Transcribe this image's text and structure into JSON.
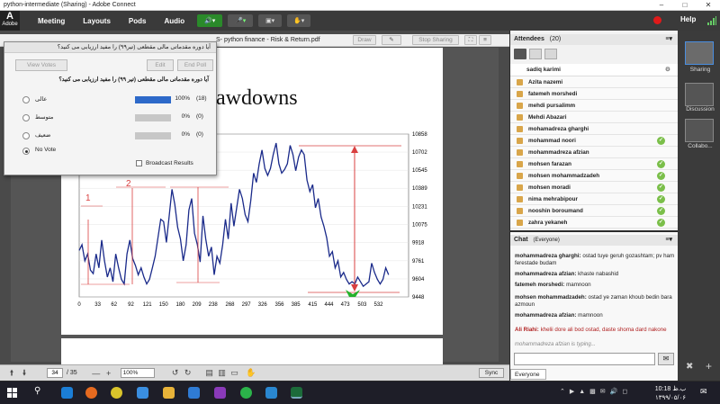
{
  "window": {
    "title": "python-intermediate (Sharing) - Adobe Connect"
  },
  "menubar": {
    "logo_top": "",
    "logo_text": "Adobe",
    "items": [
      "Meeting",
      "Layouts",
      "Pods",
      "Audio"
    ],
    "help": "Help"
  },
  "share_pod": {
    "title": "S- python finance - Risk & Return.pdf",
    "draw": "Draw",
    "stop": "Stop Sharing"
  },
  "slide": {
    "title_partial": "rawdowns"
  },
  "poll": {
    "title": "آیا دوره مقدماتی مالی مقطعی (تیر۹۹) را مفید ارزیابی می کنید؟",
    "view_votes": "View Votes",
    "edit": "Edit",
    "end_poll": "End Poll",
    "question": "آیا دوره مقدماتی مالی مقطعی (تیر ۹۹) را مفید ارزیابی می کنید؟",
    "options": [
      {
        "label": "عالی",
        "percent": "100%",
        "count": "(18)",
        "fraction": 1.0
      },
      {
        "label": "متوسط",
        "percent": "0%",
        "count": "(0)",
        "fraction": 0
      },
      {
        "label": "ضعیف",
        "percent": "0%",
        "count": "(0)",
        "fraction": 0
      }
    ],
    "no_vote": "No Vote",
    "broadcast": "Broadcast Results"
  },
  "chart_data": {
    "type": "line",
    "x_ticks": [
      0,
      33,
      62,
      92,
      121,
      150,
      180,
      209,
      238,
      268,
      297,
      326,
      356,
      385,
      415,
      444,
      473,
      503,
      532
    ],
    "y_ticks": [
      10858,
      10702,
      10545,
      10389,
      10231,
      10075,
      9918,
      9761,
      9604,
      9448
    ],
    "xlim": [
      0,
      560
    ],
    "ylim": [
      9448,
      10858
    ],
    "annotations": [
      "1",
      "2"
    ],
    "series": [
      {
        "x": [
          0,
          5,
          10,
          15,
          20,
          25,
          30,
          35,
          40,
          45,
          50,
          55,
          60,
          65,
          70,
          75,
          80,
          85,
          90,
          95,
          100,
          105,
          110,
          115,
          120,
          125,
          130,
          135,
          140,
          145,
          150,
          155,
          160,
          165,
          170,
          175,
          180,
          185,
          190,
          195,
          200,
          205,
          210,
          215,
          220,
          225,
          230,
          235,
          240,
          245,
          250,
          255,
          260,
          265,
          270,
          275,
          280,
          285,
          290,
          295,
          300,
          305,
          310,
          315,
          320,
          325,
          330,
          335,
          340,
          345,
          350,
          355,
          360,
          365,
          370,
          375,
          380,
          385,
          390,
          395,
          400,
          405,
          410,
          415,
          420,
          425,
          430,
          435,
          440,
          445,
          450,
          455,
          460,
          465,
          470,
          475,
          480,
          485,
          490,
          495,
          500,
          505,
          510,
          515,
          520,
          525,
          530,
          535,
          540,
          545,
          550
        ],
        "y": [
          9850,
          9900,
          9760,
          9820,
          9680,
          9650,
          9820,
          9700,
          9940,
          9760,
          9620,
          9700,
          9580,
          9820,
          9700,
          9600,
          9560,
          9820,
          9940,
          9780,
          9720,
          9640,
          9700,
          9620,
          9560,
          9600,
          9700,
          9800,
          9960,
          10120,
          10100,
          9920,
          10150,
          10380,
          10250,
          10050,
          9950,
          9760,
          9900,
          10200,
          10300,
          10000,
          9900,
          9750,
          10150,
          9950,
          9800,
          9880,
          9640,
          9800,
          9740,
          9900,
          10120,
          9950,
          10260,
          10060,
          10220,
          10380,
          10300,
          10160,
          10100,
          10280,
          10520,
          10440,
          10600,
          10720,
          10560,
          10500,
          10560,
          10680,
          10780,
          10600,
          10520,
          10550,
          10600,
          10760,
          10680,
          10540,
          10660,
          10720,
          10680,
          10460,
          10360,
          10420,
          10220,
          10300,
          10140,
          10060,
          9960,
          9800,
          9840,
          9700,
          9760,
          9620,
          9660,
          9600,
          9560,
          9580,
          9560,
          9620,
          9580,
          9540,
          9560,
          9580,
          9740,
          9660,
          9600,
          9560,
          9600,
          9700,
          9640
        ]
      }
    ]
  },
  "bottombar": {
    "page": "34",
    "of": "/ 35",
    "zoom": "100%",
    "sync": "Sync"
  },
  "attendees": {
    "title": "Attendees",
    "count": "(20)",
    "host": "sadiq karimi",
    "people": [
      {
        "name": "Azita nazemi",
        "check": false
      },
      {
        "name": "fatemeh morshedi",
        "check": false
      },
      {
        "name": "mehdi pursalimm",
        "check": false
      },
      {
        "name": "Mehdi Abazari",
        "check": false
      },
      {
        "name": "mohamadreza gharghi",
        "check": false
      },
      {
        "name": "mohammad noori",
        "check": true
      },
      {
        "name": "mohammadreza afzian",
        "check": false
      },
      {
        "name": "mohsen farazan",
        "check": true
      },
      {
        "name": "mohsen mohammadzadeh",
        "check": true
      },
      {
        "name": "mohsen moradi",
        "check": true
      },
      {
        "name": "nima mehrabipour",
        "check": true
      },
      {
        "name": "nooshin boroumand",
        "check": true
      },
      {
        "name": "zahra yekaneh",
        "check": true
      }
    ]
  },
  "chat": {
    "title": "Chat",
    "scope": "(Everyone)",
    "messages": [
      {
        "name": "mohammadreza gharghi:",
        "text": "ostad tuye geruh gozashtam; pv ham ferestade budam"
      },
      {
        "name": "mohammadreza afzian:",
        "text": "khaste nabashid"
      },
      {
        "name": "fatemeh morshedi:",
        "text": "mamnoon"
      },
      {
        "name": "mohsen mohammadzadeh:",
        "text": "ostad ye zaman khoub bedin bara azmoun"
      },
      {
        "name": "mohammadreza afzian:",
        "text": "mamnoon"
      },
      {
        "name": "Ali Riahi:",
        "text": "khelii dore ali bod ostad, daste shoma dard nakone"
      }
    ],
    "typing": "mohammadreza afzian is typing...",
    "tab": "Everyone"
  },
  "layouts": [
    "Sharing",
    "Discussion",
    "Collabo..."
  ],
  "taskbar": {
    "time": "10:18 ب.ظ",
    "date": "۱۳۹۹/۰۵/۰۶"
  },
  "colors": {
    "accent": "#2d69c9",
    "line": "#1a2a8a",
    "annot": "#d94040"
  }
}
